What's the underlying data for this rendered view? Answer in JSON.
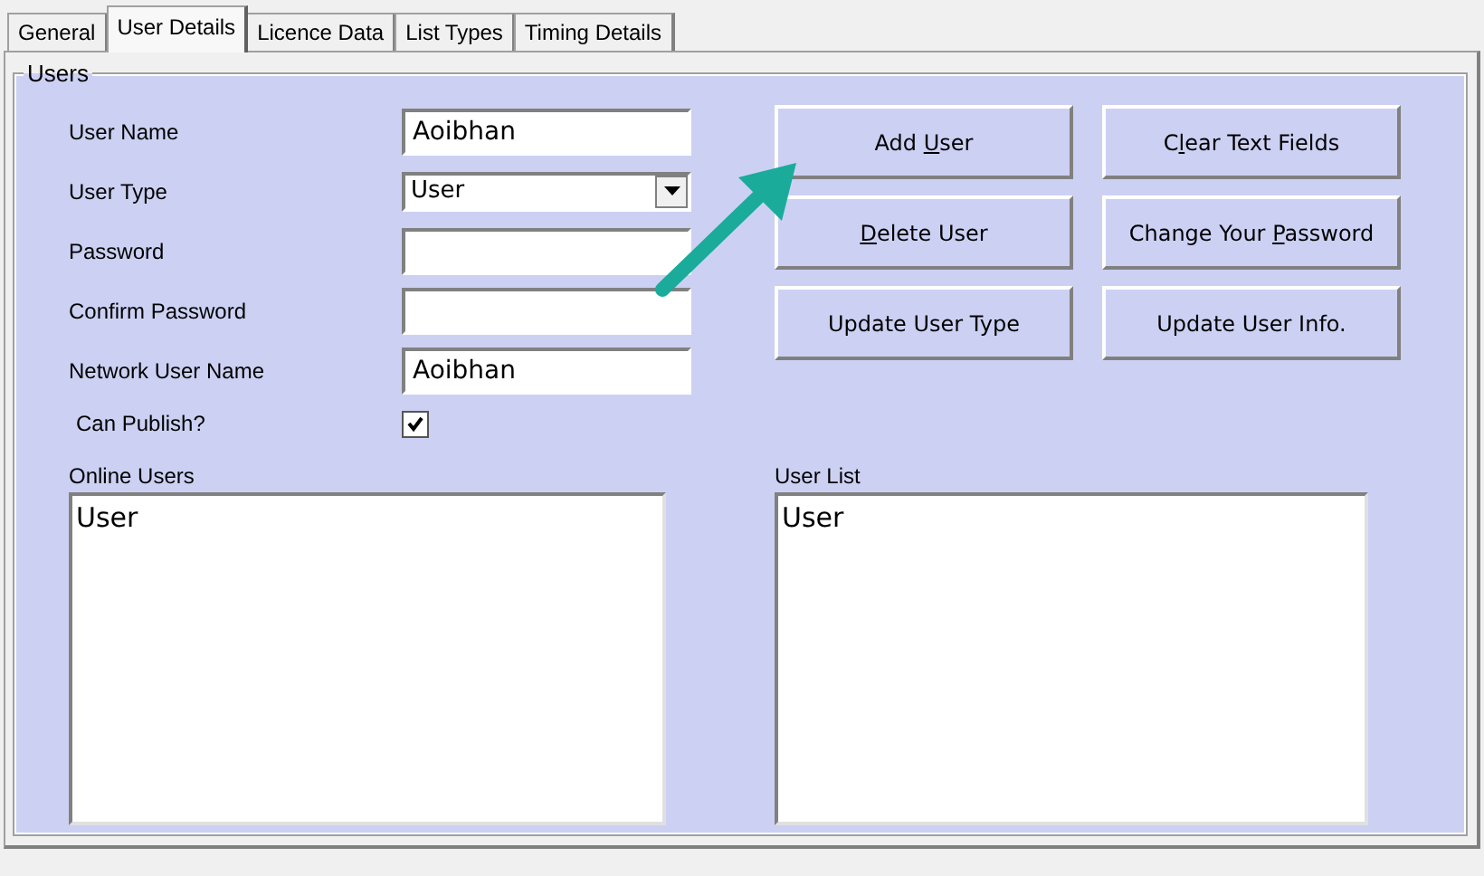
{
  "tabs": [
    {
      "label": "General",
      "selected": false
    },
    {
      "label": "User Details",
      "selected": true
    },
    {
      "label": "Licence Data",
      "selected": false
    },
    {
      "label": "List Types",
      "selected": false
    },
    {
      "label": "Timing Details",
      "selected": false
    }
  ],
  "users": {
    "title": "Users",
    "fields": [
      {
        "kind": "text",
        "label": "User Name",
        "value": "Aoibhan"
      },
      {
        "kind": "dropdown",
        "label": "User Type",
        "value": "User"
      },
      {
        "kind": "text",
        "label": "Password"
      },
      {
        "kind": "text",
        "label": "Confirm Password"
      },
      {
        "kind": "text",
        "label": "Network User Name",
        "value": "Aoibhan"
      },
      {
        "kind": "checkbox",
        "label": "Can Publish?",
        "checked": true
      }
    ],
    "buttons": [
      {
        "before": "Add ",
        "key": "U",
        "after": "ser"
      },
      {
        "before": "C",
        "key": "l",
        "after": "ear Text Fields"
      },
      {
        "key": "D",
        "after": "elete User"
      },
      {
        "before": "Change Your ",
        "key": "P",
        "after": "assword"
      },
      {
        "before": "Update User Type"
      },
      {
        "before": "Update User Info."
      }
    ],
    "lists": [
      {
        "title": "Online Users",
        "items": [
          "User"
        ]
      },
      {
        "title": "User List",
        "items": [
          "User"
        ]
      }
    ]
  }
}
